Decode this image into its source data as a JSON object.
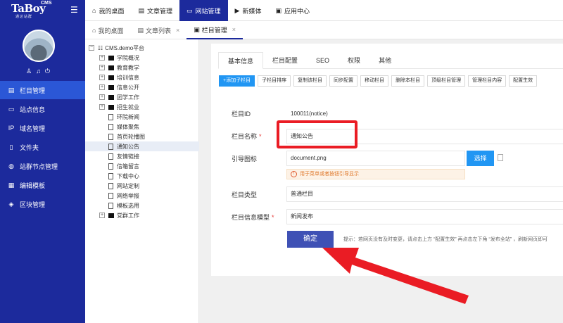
{
  "logo": {
    "brand": "TaBoy",
    "cms": "CMS",
    "tagline": "通达站群"
  },
  "sidebar": {
    "items": [
      {
        "label": "栏目管理",
        "icon": "column-icon",
        "glyph": "▤"
      },
      {
        "label": "站点信息",
        "icon": "monitor-icon",
        "glyph": "▭"
      },
      {
        "label": "域名管理",
        "icon": "ip-icon",
        "glyph": "IP"
      },
      {
        "label": "文件夹",
        "icon": "file-icon",
        "glyph": "▯"
      },
      {
        "label": "站群节点管理",
        "icon": "globe-icon",
        "glyph": "◍"
      },
      {
        "label": "编辑模板",
        "icon": "template-icon",
        "glyph": "▦"
      },
      {
        "label": "区块管理",
        "icon": "layers-icon",
        "glyph": "◈"
      }
    ]
  },
  "topbar": {
    "tabs": [
      {
        "label": "我的桌面",
        "glyph": "⌂"
      },
      {
        "label": "文章管理",
        "glyph": "▤"
      },
      {
        "label": "网站管理",
        "glyph": "▭"
      },
      {
        "label": "新媒体",
        "glyph": "▶"
      },
      {
        "label": "应用中心",
        "glyph": "▣"
      }
    ]
  },
  "pagetabs": {
    "tabs": [
      {
        "label": "我的桌面",
        "glyph": "⌂",
        "close": ""
      },
      {
        "label": "文章列表",
        "glyph": "▤",
        "close": "×"
      },
      {
        "label": "栏目管理",
        "glyph": "▣",
        "close": "×"
      }
    ]
  },
  "tree": {
    "root": "CMS.demo平台",
    "nodes": [
      {
        "label": "学院概况",
        "kind": "folder"
      },
      {
        "label": "教育教学",
        "kind": "folder"
      },
      {
        "label": "培训信息",
        "kind": "folder"
      },
      {
        "label": "信息公开",
        "kind": "folder"
      },
      {
        "label": "团学工作",
        "kind": "folder"
      },
      {
        "label": "招生就业",
        "kind": "folder"
      },
      {
        "label": "环院新闻",
        "kind": "page"
      },
      {
        "label": "媒体聚焦",
        "kind": "page"
      },
      {
        "label": "首页轮播图",
        "kind": "page"
      },
      {
        "label": "通知公告",
        "kind": "page"
      },
      {
        "label": "友情链接",
        "kind": "page"
      },
      {
        "label": "信箱留言",
        "kind": "page"
      },
      {
        "label": "下载中心",
        "kind": "page"
      },
      {
        "label": "网站定制",
        "kind": "page"
      },
      {
        "label": "网络举报",
        "kind": "page"
      },
      {
        "label": "模板选用",
        "kind": "page"
      },
      {
        "label": "党群工作",
        "kind": "folder"
      }
    ]
  },
  "panel": {
    "subtabs": [
      "基本信息",
      "栏目配置",
      "SEO",
      "权限",
      "其他"
    ],
    "toolbar": [
      "+添加子栏目",
      "子栏目排序",
      "复制该栏目",
      "同步配置",
      "移动栏目",
      "删除本栏目",
      "顶级栏目管理",
      "管理栏目内容",
      "配置生效"
    ],
    "form": {
      "id_label": "栏目ID",
      "id_value": "100011(notice)",
      "name_label": "栏目名称",
      "name_value": "通知公告",
      "icon_label": "引导图标",
      "icon_value": "document.png",
      "choose_label": "选择",
      "icon_hint": "用于菜单或者按钮引导显示",
      "type_label": "栏目类型",
      "type_value": "普通栏目",
      "model_label": "栏目信息模型",
      "model_value": "新闻发布",
      "required_mark": "*",
      "confirm_label": "确定",
      "tip": "提示：若网页没有及时变更，请点击上方 “配置生效” 再点击左下角 “发布全站” ，刷新网页即可"
    }
  },
  "colors": {
    "sidebar": "#1c2a9c",
    "accent": "#2196f3",
    "highlight": "#ea1c24",
    "confirm": "#3f51b5"
  }
}
